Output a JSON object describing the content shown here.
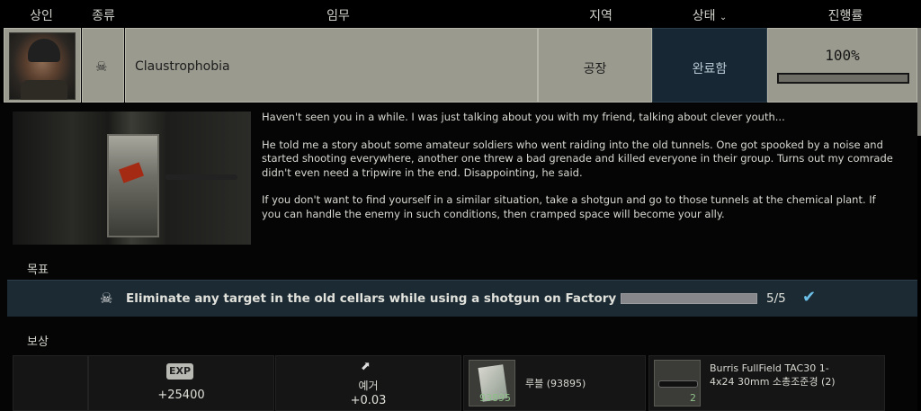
{
  "header": {
    "trader": "상인",
    "type": "종류",
    "task": "임무",
    "location": "지역",
    "status": "상태",
    "status_icon": "chevron-down-icon",
    "progress": "진행률"
  },
  "quest": {
    "name": "Claustrophobia",
    "type_icon": "skull-icon",
    "location": "공장",
    "status": "완료함",
    "progress_text": "100%",
    "progress_value": 1.0
  },
  "details": {
    "story": [
      "Haven't seen you in a while. I was just talking about you with my friend, talking about clever youth...",
      "He told me a story about some amateur soldiers who went raiding into the old tunnels. One got spooked by a noise and started shooting everywhere, another one threw a bad grenade and killed everyone in their group. Turns out my comrade didn't even need a tripwire in the end. Disappointing, he said.",
      "If you don't want to find yourself in a similar situation, take a shotgun and go to those tunnels at the chemical plant. If you can handle the enemy in such conditions, then cramped space will become your ally."
    ],
    "objectives_label": "목표",
    "objective": {
      "text": "Eliminate any target in the old cellars while using a shotgun on Factory",
      "count": "5/5",
      "progress_value": 1.0
    },
    "rewards_label": "보상",
    "rewards": {
      "exp_badge": "EXP",
      "exp_value": "+25400",
      "rep_name": "예거",
      "rep_value": "+0.03",
      "money_label": "루블",
      "money_amount": "(93895)",
      "money_slot": "93895",
      "item_label": "Burris FullField TAC30 1-4x24 30mm 소총조준경 (2)",
      "item_slot": "2"
    }
  },
  "colors": {
    "row_bg": "#9a9a8f",
    "status_bg": "#172733",
    "objective_bg": "#1b2a33",
    "check": "#6cc0e8"
  }
}
